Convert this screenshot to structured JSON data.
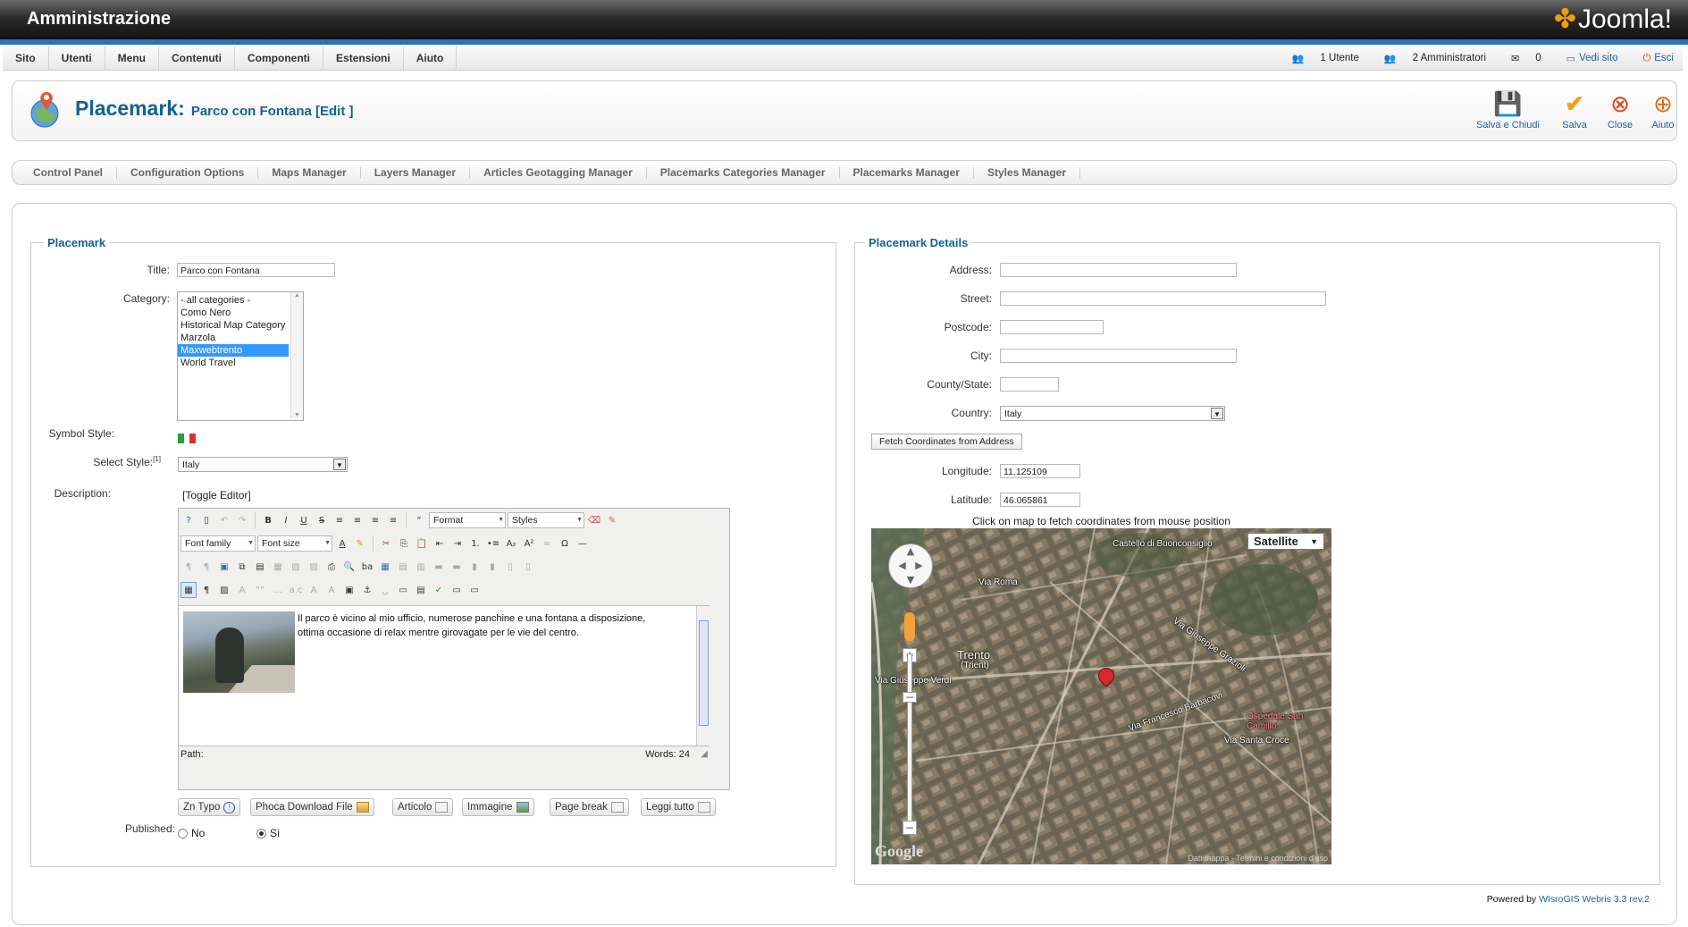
{
  "header": {
    "title": "Amministrazione",
    "logo_text": "Joomla!"
  },
  "menu": {
    "items": [
      "Sito",
      "Utenti",
      "Menu",
      "Contenuti",
      "Componenti",
      "Estensioni",
      "Aiuto"
    ]
  },
  "status": {
    "users": "1 Utente",
    "admins": "2 Amministratori",
    "messages": "0",
    "view_site": "Vedi sito",
    "logout": "Esci"
  },
  "page": {
    "title": "Placemark:",
    "subtitle": "Parco con Fontana [Edit ]"
  },
  "toolbar": {
    "save_close": "Salva e Chiudi",
    "save": "Salva",
    "close": "Close",
    "help": "Aiuto"
  },
  "submenu": {
    "items": [
      "Control Panel",
      "Configuration Options",
      "Maps Manager",
      "Layers Manager",
      "Articles Geotagging Manager",
      "Placemarks Categories Manager",
      "Placemarks Manager",
      "Styles Manager"
    ]
  },
  "placemark": {
    "legend": "Placemark",
    "title_label": "Title:",
    "title_value": "Parco con Fontana",
    "category_label": "Category:",
    "categories": [
      "- all categories -",
      "Como Nero",
      "Historical Map Category",
      "Marzola",
      "Maxwebtrento",
      "World Travel"
    ],
    "selected_category": "Maxwebtrento",
    "symbol_style_label": "Symbol Style:",
    "select_style_label": "Select Style:",
    "select_style_note": "[1]",
    "select_style_value": "Italy",
    "description_label": "Description:",
    "toggle_editor": "[Toggle Editor]",
    "editor": {
      "format": "Format",
      "styles": "Styles",
      "font_family": "Font family",
      "font_size": "Font size",
      "content": "Il parco è vicino al mio ufficio, numerose panchine e una fontana a disposizione, ottima occasione di relax mentre girovagate per le vie del centro.",
      "path": "Path:",
      "words": "Words: 24"
    },
    "extra_buttons": [
      "Zn Typo",
      "Phoca Download File",
      "Articolo",
      "Immagine",
      "Page break",
      "Leggi tutto"
    ],
    "published_label": "Published:",
    "published_no": "No",
    "published_yes": "Sì",
    "published_value": "Sì"
  },
  "details": {
    "legend": "Placemark Details",
    "address_label": "Address:",
    "address_value": "",
    "street_label": "Street:",
    "street_value": "",
    "postcode_label": "Postcode:",
    "postcode_value": "",
    "city_label": "City:",
    "city_value": "",
    "county_label": "County/State:",
    "county_value": "",
    "country_label": "Country:",
    "country_value": "Italy",
    "fetch_button": "Fetch Coordinates from Address",
    "longitude_label": "Longitude:",
    "longitude_value": "11.125109",
    "latitude_label": "Latitude:",
    "latitude_value": "46.065861",
    "map_hint": "Click on map to fetch coordinates from mouse position",
    "map_type": "Satellite",
    "map_terms": "Dati mappa - Termini e condizioni d'uso",
    "map_logo": "Google",
    "map_labels": [
      "Trento",
      "(Trient)",
      "Castello di Buonconsiglio",
      "Via Roma",
      "Via Giuseppe Verdi",
      "Via Francesco Barbacovi",
      "Via Giuseppe Grazioli",
      "Ospedale San Camillo",
      "Via Santa Croce",
      "Via Belenzani",
      "Via Oss Mazzurana",
      "Via Giuseppe Grazioli"
    ]
  },
  "footer": {
    "powered_prefix": "Powered by ",
    "powered_link": "WIsroGIS Webris 3.3 rev.2"
  }
}
